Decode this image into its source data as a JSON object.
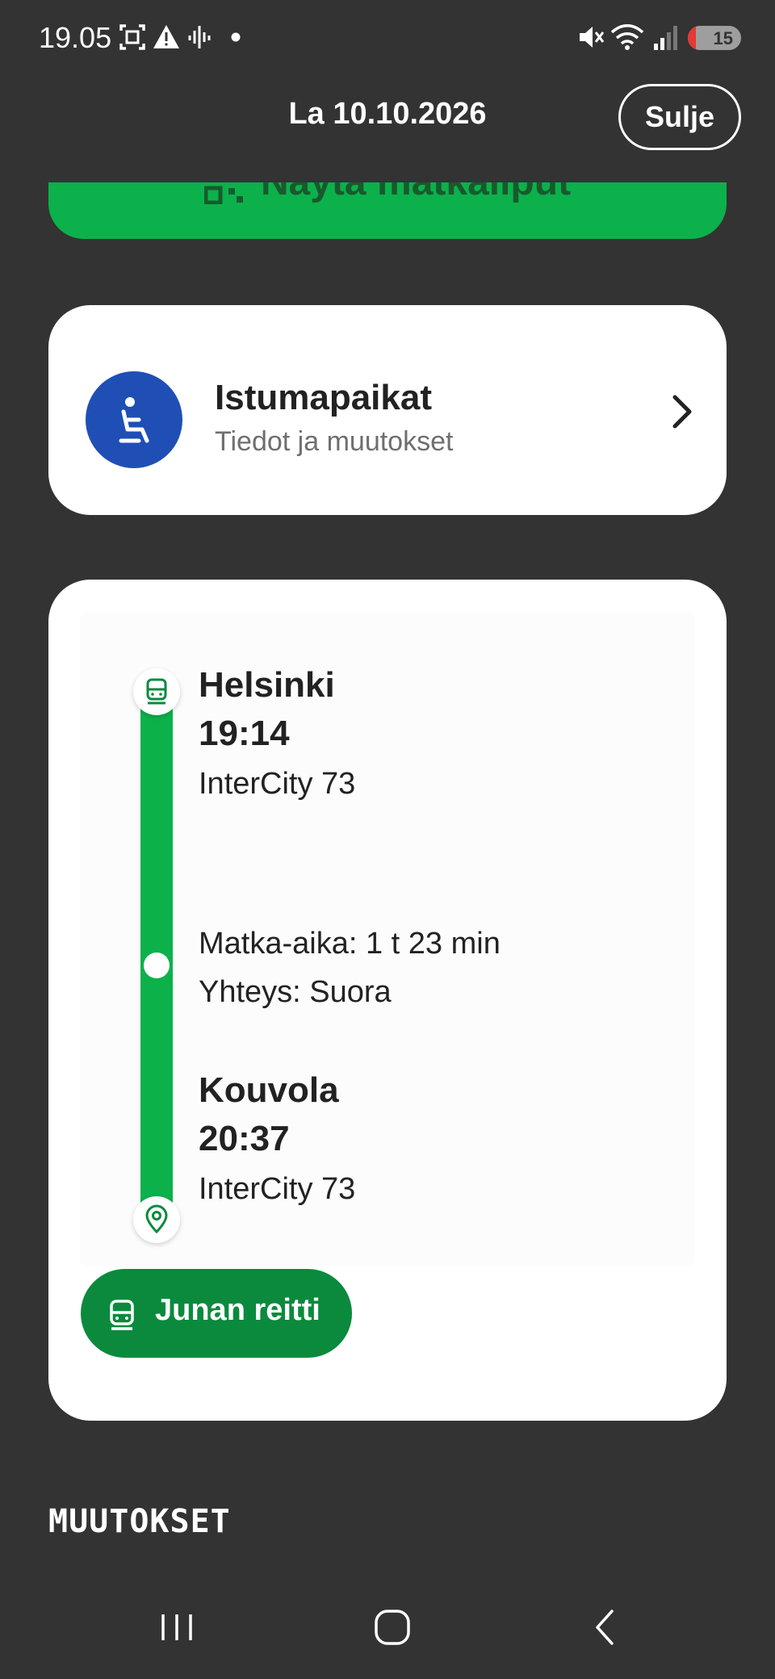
{
  "status_bar": {
    "time": "19.05",
    "battery_level": "15",
    "battery_fraction": 0.15,
    "icons": [
      "screenshot-icon",
      "warning-icon",
      "audio-wave-icon",
      "dot-icon",
      "mute-icon",
      "wifi-icon",
      "signal-icon",
      "battery-icon"
    ]
  },
  "header": {
    "date": "La 10.10.2026",
    "close_label": "Sulje"
  },
  "tickets_button": {
    "label": "Näytä matkaliput",
    "icon": "qr-code-icon"
  },
  "seats_card": {
    "title": "Istumapaikat",
    "subtitle": "Tiedot ja muutokset",
    "icon": "seat-icon"
  },
  "route": {
    "departure": {
      "station": "Helsinki",
      "time": "19:14",
      "train": "InterCity 73"
    },
    "travel_time": "Matka-aika: 1 t 23 min",
    "connection": "Yhteys: Suora",
    "arrival": {
      "station": "Kouvola",
      "time": "20:37",
      "train": "InterCity 73"
    },
    "route_button_label": "Junan reitti"
  },
  "section": {
    "title": "MUUTOKSET"
  },
  "colors": {
    "background": "#333333",
    "accent_green": "#0cb14b",
    "dark_green": "#0b8a3d",
    "seat_blue": "#1f4fb5"
  }
}
